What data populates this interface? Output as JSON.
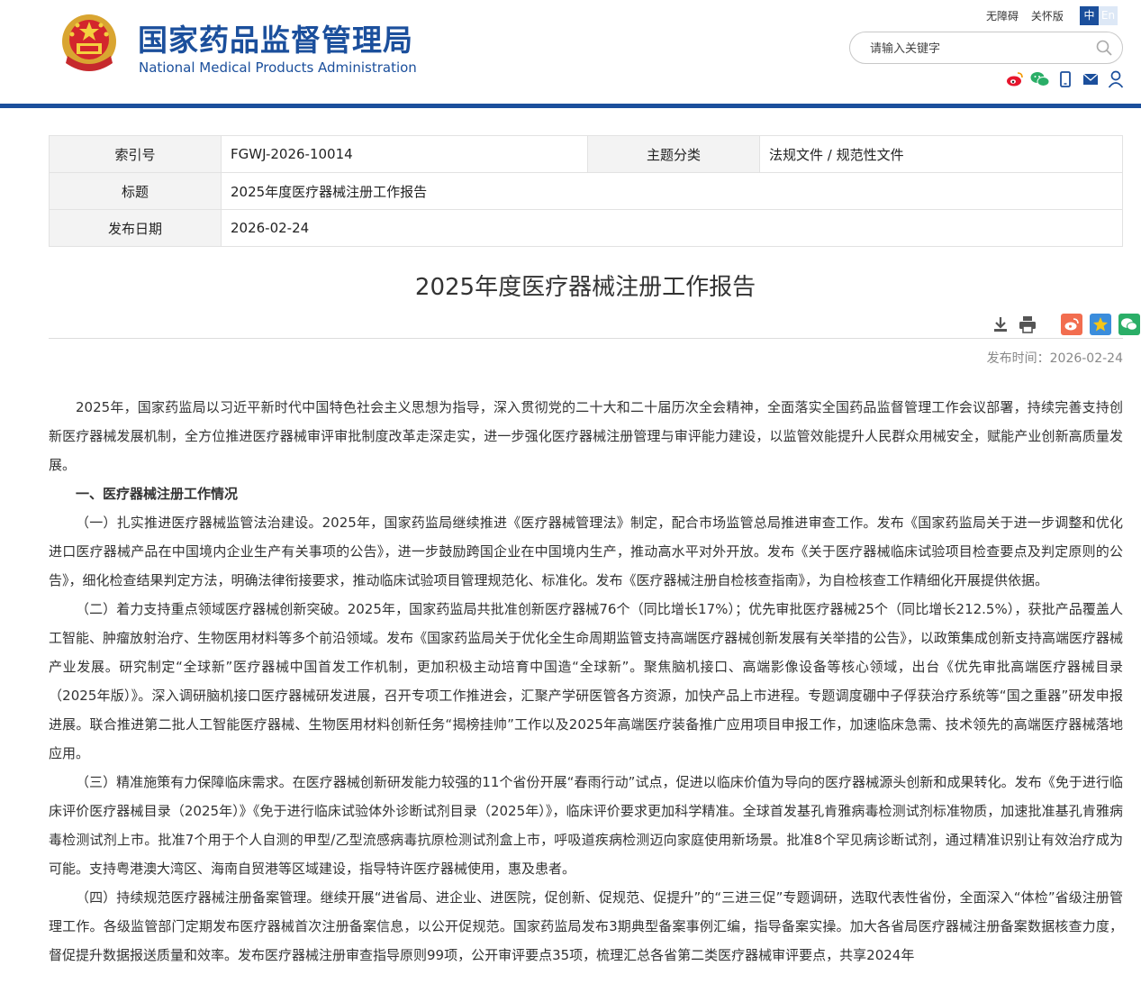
{
  "header": {
    "title_cn": "国家药品监督管理局",
    "title_en": "National Medical Products Administration",
    "utility_links": [
      "无障碍",
      "关怀版"
    ],
    "lang_active": "中",
    "lang_inactive": "En",
    "search_placeholder": "请输入关键字",
    "brand_color": "#1b4f9c",
    "social_icons": [
      "weibo-icon",
      "wechat-icon",
      "mobile-icon",
      "mail-icon",
      "user-icon"
    ]
  },
  "meta": {
    "index_label": "索引号",
    "index_value": "FGWJ-2026-10014",
    "category_label": "主题分类",
    "category_value": "法规文件 / 规范性文件",
    "title_label": "标题",
    "title_value": "2025年度医疗器械注册工作报告",
    "date_label": "发布日期",
    "date_value": "2026-02-24"
  },
  "article": {
    "title": "2025年度医疗器械注册工作报告",
    "publish_time": "发布时间：2026-02-24",
    "tool_icons": [
      "download-icon",
      "print-icon",
      "share-weibo-icon",
      "favorite-icon",
      "share-wechat-icon"
    ],
    "paragraphs": [
      "2025年，国家药监局以习近平新时代中国特色社会主义思想为指导，深入贯彻党的二十大和二十届历次全会精神，全面落实全国药品监督管理工作会议部署，持续完善支持创新医疗器械发展机制，全方位推进医疗器械审评审批制度改革走深走实，进一步强化医疗器械注册管理与审评能力建设，以监管效能提升人民群众用械安全，赋能产业创新高质量发展。",
      "一、医疗器械注册工作情况",
      "（一）扎实推进医疗器械监管法治建设。2025年，国家药监局继续推进《医疗器械管理法》制定，配合市场监管总局推进审查工作。发布《国家药监局关于进一步调整和优化进口医疗器械产品在中国境内企业生产有关事项的公告》，进一步鼓励跨国企业在中国境内生产，推动高水平对外开放。发布《关于医疗器械临床试验项目检查要点及判定原则的公告》，细化检查结果判定方法，明确法律衔接要求，推动临床试验项目管理规范化、标准化。发布《医疗器械注册自检核查指南》，为自检核查工作精细化开展提供依据。",
      "（二）着力支持重点领域医疗器械创新突破。2025年，国家药监局共批准创新医疗器械76个（同比增长17%）；优先审批医疗器械25个（同比增长212.5%），获批产品覆盖人工智能、肿瘤放射治疗、生物医用材料等多个前沿领域。发布《国家药监局关于优化全生命周期监管支持高端医疗器械创新发展有关举措的公告》，以政策集成创新支持高端医疗器械产业发展。研究制定“全球新”医疗器械中国首发工作机制，更加积极主动培育中国造“全球新”。聚焦脑机接口、高端影像设备等核心领域，出台《优先审批高端医疗器械目录（2025年版）》。深入调研脑机接口医疗器械研发进展，召开专项工作推进会，汇聚产学研医管各方资源，加快产品上市进程。专题调度硼中子俘获治疗系统等“国之重器”研发申报进展。联合推进第二批人工智能医疗器械、生物医用材料创新任务“揭榜挂帅”工作以及2025年高端医疗装备推广应用项目申报工作，加速临床急需、技术领先的高端医疗器械落地应用。",
      "（三）精准施策有力保障临床需求。在医疗器械创新研发能力较强的11个省份开展“春雨行动”试点，促进以临床价值为导向的医疗器械源头创新和成果转化。发布《免于进行临床评价医疗器械目录（2025年）》《免于进行临床试验体外诊断试剂目录（2025年）》，临床评价要求更加科学精准。全球首发基孔肯雅病毒检测试剂标准物质，加速批准基孔肯雅病毒检测试剂上市。批准7个用于个人自测的甲型/乙型流感病毒抗原检测试剂盒上市，呼吸道疾病检测迈向家庭使用新场景。批准8个罕见病诊断试剂，通过精准识别让有效治疗成为可能。支持粤港澳大湾区、海南自贸港等区域建设，指导特许医疗器械使用，惠及患者。",
      "（四）持续规范医疗器械注册备案管理。继续开展“进省局、进企业、进医院，促创新、促规范、促提升”的“三进三促”专题调研，选取代表性省份，全面深入“体检”省级注册管理工作。各级监管部门定期发布医疗器械首次注册备案信息，以公开促规范。国家药监局发布3期典型备案事例汇编，指导备案实操。加大各省局医疗器械注册备案数据核查力度，督促提升数据报送质量和效率。发布医疗器械注册审查指导原则99项，公开审评要点35项，梳理汇总各省第二类医疗器械审评要点，共享2024年"
    ]
  }
}
